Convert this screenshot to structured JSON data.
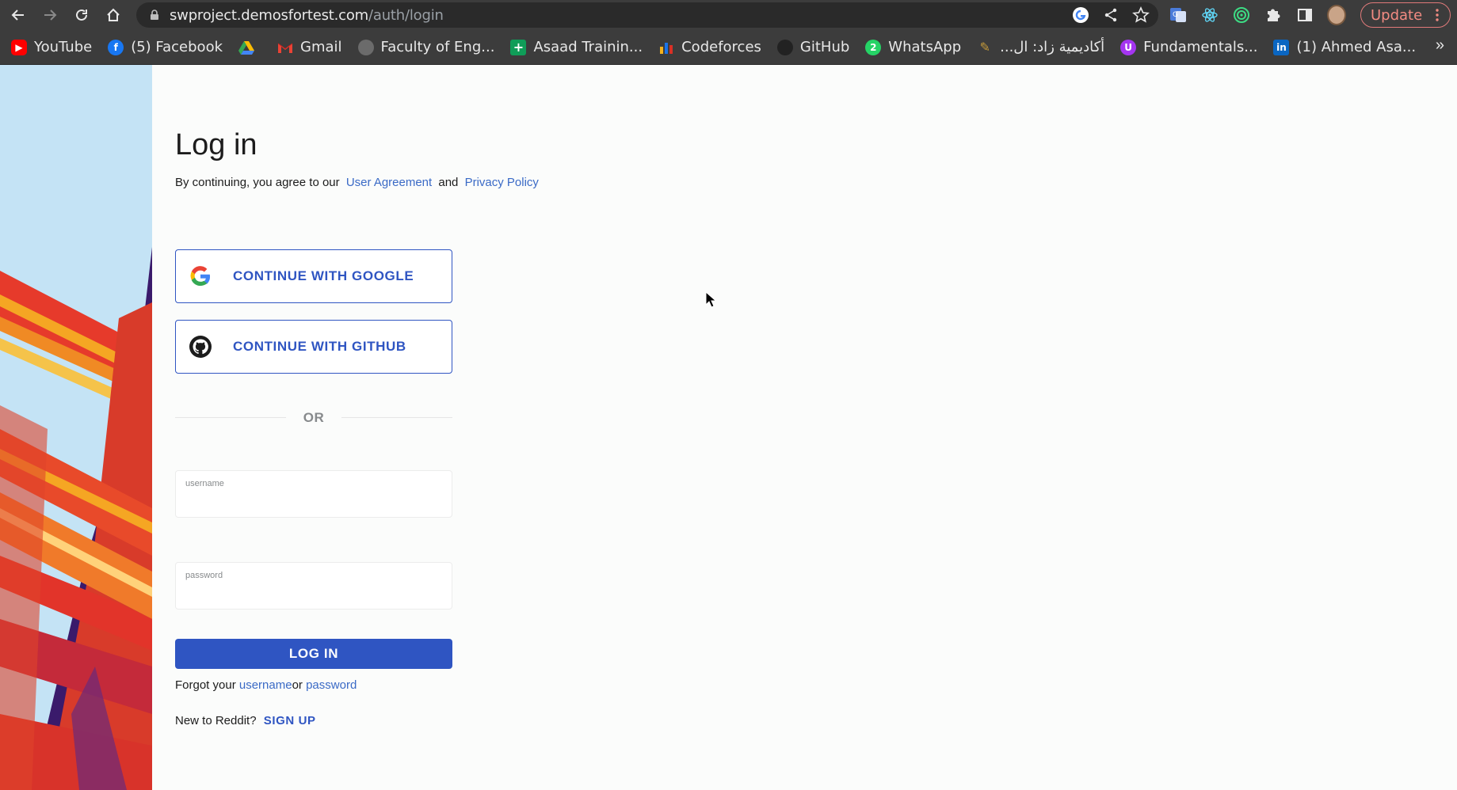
{
  "browser": {
    "url_host": "swproject.demosfortest.com",
    "url_path": "/auth/login",
    "update_label": "Update",
    "bookmarks": [
      {
        "label": "YouTube",
        "icon": "youtube-icon",
        "color": "#ff0000"
      },
      {
        "label": "(5) Facebook",
        "icon": "facebook-icon",
        "color": "#1877f2"
      },
      {
        "label": "",
        "icon": "google-drive-icon",
        "color": "#34a853"
      },
      {
        "label": "Gmail",
        "icon": "gmail-icon",
        "color": "#ea4335"
      },
      {
        "label": "Faculty of Eng...",
        "icon": "globe-icon",
        "color": "#5f6368"
      },
      {
        "label": "Asaad Trainin...",
        "icon": "plus-icon",
        "color": "#0f9d58"
      },
      {
        "label": "Codeforces",
        "icon": "codeforces-icon",
        "color": "#f5b21b"
      },
      {
        "label": "GitHub",
        "icon": "github-icon",
        "color": "#222222"
      },
      {
        "label": "WhatsApp",
        "icon": "whatsapp-icon",
        "color": "#25d366"
      },
      {
        "label": "أكاديمية زاد: ال...",
        "icon": "zad-icon",
        "color": "#c59a3a"
      },
      {
        "label": "Fundamentals...",
        "icon": "udemy-icon",
        "color": "#a435f0"
      },
      {
        "label": "(1) Ahmed Asa...",
        "icon": "linkedin-icon",
        "color": "#0a66c2"
      }
    ],
    "more_label": "»"
  },
  "page": {
    "title": "Log in",
    "agree_prefix": "By continuing, you agree to our",
    "user_agreement": "User Agreement",
    "and": "and",
    "privacy_policy": "Privacy Policy",
    "google_label": "CONTINUE WITH GOOGLE",
    "github_label": "CONTINUE WITH GITHUB",
    "or_label": "OR",
    "username_label": "username",
    "username_value": "",
    "password_label": "password",
    "password_value": "",
    "login_label": "LOG IN",
    "forgot_prefix": "Forgot your",
    "forgot_username": "username",
    "forgot_or": "or",
    "forgot_password": "password",
    "new_prefix": "New to Reddit?",
    "signup_label": "SIGN UP"
  },
  "colors": {
    "accent": "#2f55c2",
    "link": "#3a6ac6",
    "chrome": "#3c3c3c",
    "page_bg": "#fbfcfb"
  }
}
